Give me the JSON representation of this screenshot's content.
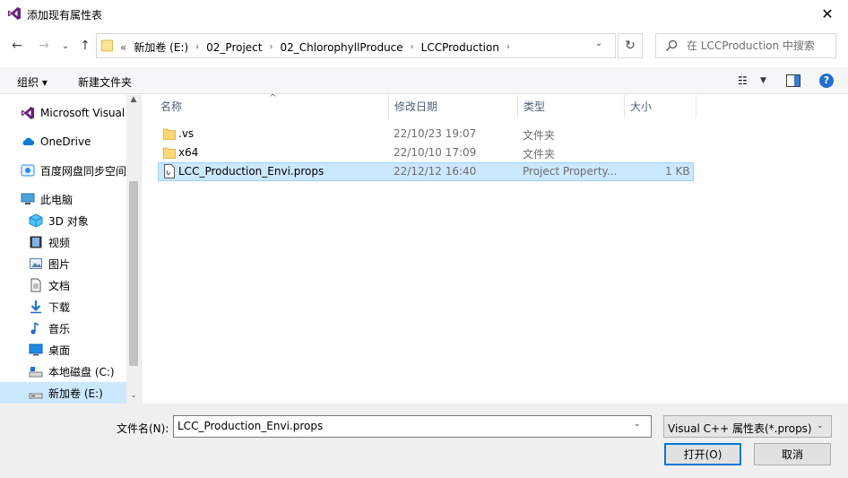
{
  "window": {
    "title": "添加现有属性表",
    "close_glyph": "✕",
    "accent_color": "#68217a"
  },
  "nav": {
    "back_glyph": "←",
    "forward_glyph": "→",
    "recent_glyph": "⌄",
    "up_glyph": "↑",
    "address_prefix": "«",
    "breadcrumbs": [
      "新加卷 (E:)",
      "02_Project",
      "02_ChlorophyllProduce",
      "LCCProduction"
    ],
    "crumb_separator": "›",
    "refresh_glyph": "↻",
    "search_placeholder": "在 LCCProduction 中搜索"
  },
  "toolbar": {
    "organize_label": "组织 ▾",
    "new_folder_label": "新建文件夹",
    "view_glyph": "☷",
    "view_dropdown_glyph": "▼",
    "help_glyph": "?"
  },
  "sidebar": {
    "items": [
      {
        "label": "Microsoft Visual",
        "icon": "visual-studio-icon"
      },
      {
        "label": "OneDrive",
        "icon": "onedrive-icon"
      },
      {
        "label": "百度网盘同步空间",
        "icon": "baidu-netdisk-icon"
      },
      {
        "label": "此电脑",
        "icon": "this-pc-icon"
      },
      {
        "label": "3D 对象",
        "icon": "3d-objects-icon"
      },
      {
        "label": "视频",
        "icon": "video-icon"
      },
      {
        "label": "图片",
        "icon": "pictures-icon"
      },
      {
        "label": "文档",
        "icon": "documents-icon"
      },
      {
        "label": "下载",
        "icon": "downloads-icon"
      },
      {
        "label": "音乐",
        "icon": "music-icon"
      },
      {
        "label": "桌面",
        "icon": "desktop-icon"
      },
      {
        "label": "本地磁盘 (C:)",
        "icon": "local-disk-icon"
      },
      {
        "label": "新加卷 (E:)",
        "icon": "drive-icon"
      }
    ],
    "scroll_up_glyph": "▲",
    "scroll_down_glyph": "⌄"
  },
  "file_list": {
    "columns": [
      "名称",
      "修改日期",
      "类型",
      "大小"
    ],
    "sort_glyph": "^",
    "rows": [
      {
        "name": ".vs",
        "date": "22/10/23 19:07",
        "type": "文件夹",
        "size": "",
        "icon": "folder-icon"
      },
      {
        "name": "x64",
        "date": "22/10/10 17:09",
        "type": "文件夹",
        "size": "",
        "icon": "folder-icon"
      },
      {
        "name": "LCC_Production_Envi.props",
        "date": "22/12/12 16:40",
        "type": "Project Property...",
        "size": "1 KB",
        "icon": "props-file-icon",
        "selected": true
      }
    ]
  },
  "footer": {
    "filename_label": "文件名(N):",
    "filename_value": "LCC_Production_Envi.props",
    "filter_value": "Visual C++ 属性表(*.props)",
    "dropdown_glyph": "⌄",
    "open_label": "打开(O)",
    "cancel_label": "取消"
  }
}
